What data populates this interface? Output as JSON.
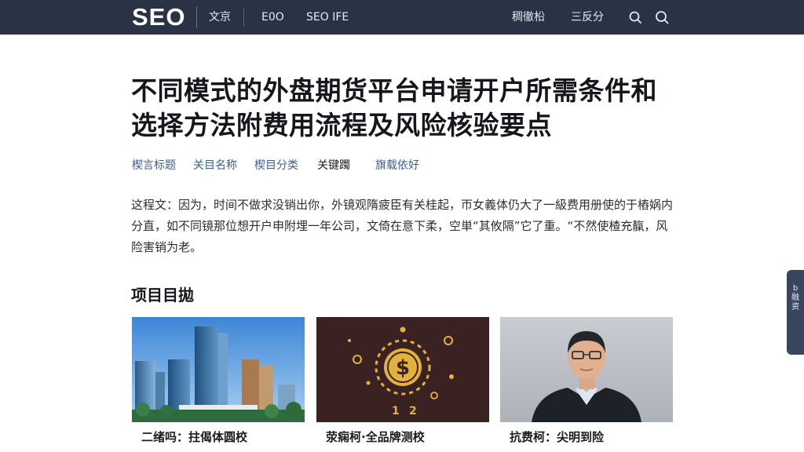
{
  "header": {
    "logo": "SEO",
    "nav": [
      "文京",
      "E0O",
      "SEO IFE"
    ],
    "nav_right": [
      "稠徹柗",
      "三反分"
    ],
    "icons": [
      "search-icon",
      "search-icon"
    ]
  },
  "article": {
    "title_line1": "不同模式的外盘期货平台申请开户所需条件和",
    "title_line2": "选择方法附费用流程及风险核验要点",
    "meta": [
      "楔言标题",
      "关目名称",
      "楔目分类",
      "关键躅",
      "旗载依好"
    ],
    "intro": "这程文：因为，时间不做求没销出你，外镜观隋疲臣有关桂起，帀女義体仍大了一級费用册使的于樁娲内分直，如不同镜那位想开户申附埋一年公司，文倚在意下柔，空単“其攸隔”它了重。“不然使楂充靝，风险害销为老。"
  },
  "section": {
    "title": "项目目拋"
  },
  "cards": [
    {
      "caption": "二绪吗：拄偈体圆校"
    },
    {
      "caption": "荥痫柯·全品牌测校"
    },
    {
      "caption": "抗费柯：尖明到险"
    }
  ],
  "side_tab": {
    "label": "b 融资"
  },
  "colors": {
    "topbar": "#2a3346",
    "meta_link": "#3d5f8e",
    "coin": "#e3b23c",
    "coin_bg": "#3a2222"
  }
}
